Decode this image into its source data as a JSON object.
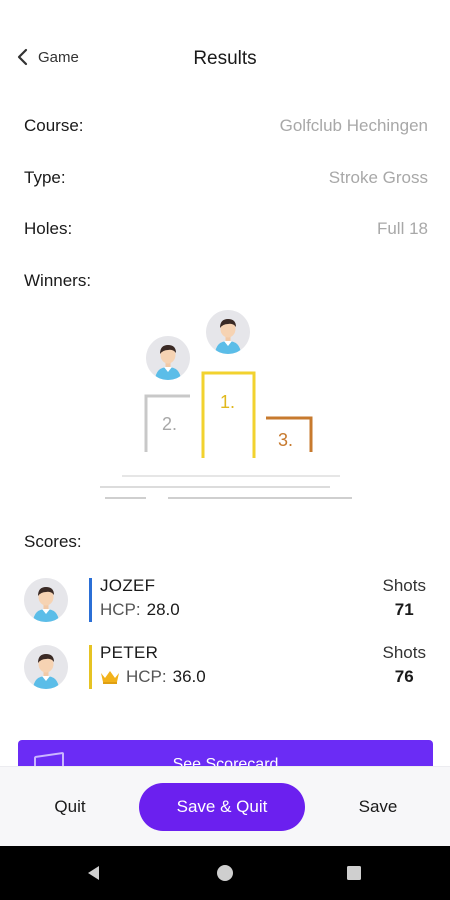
{
  "header": {
    "back_label": "Game",
    "title": "Results"
  },
  "info": [
    {
      "label": "Course:",
      "value": "Golfclub Hechingen"
    },
    {
      "label": "Type:",
      "value": "Stroke Gross"
    },
    {
      "label": "Holes:",
      "value": "Full 18"
    }
  ],
  "winners_label": "Winners:",
  "podium": {
    "first": "1.",
    "second": "2.",
    "third": "3."
  },
  "scores_label": "Scores:",
  "players": [
    {
      "name": "JOZEF",
      "hcp_label": "HCP:",
      "hcp": "28.0",
      "shots_label": "Shots",
      "shots": "71",
      "bar_color": "#2b6fd6",
      "crown": false
    },
    {
      "name": "PETER",
      "hcp_label": "HCP:",
      "hcp": "36.0",
      "shots_label": "Shots",
      "shots": "76",
      "bar_color": "#e6c323",
      "crown": true
    }
  ],
  "banner": {
    "text": "See Scorecard"
  },
  "bottom": {
    "quit": "Quit",
    "save_quit": "Save & Quit",
    "save": "Save"
  },
  "colors": {
    "accent": "#6b20ef",
    "gold": "#f2d22e",
    "silver": "#c8c8c8",
    "bronze": "#c77a2e"
  }
}
